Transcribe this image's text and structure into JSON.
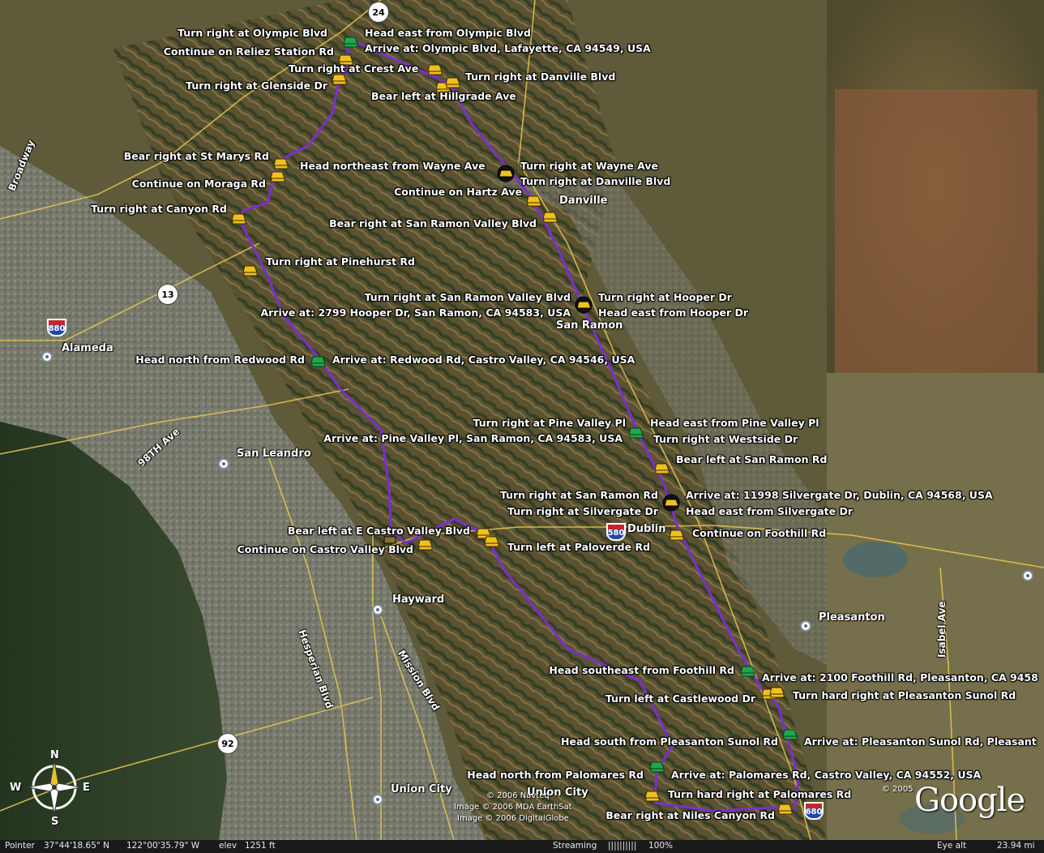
{
  "status_bar": {
    "pointer_label": "Pointer",
    "latitude": "37°44'18.65\" N",
    "longitude": "122°00'35.79\" W",
    "elev_label": "elev",
    "elevation": "1251 ft",
    "streaming_label": "Streaming",
    "streaming_bars": "||||||||||",
    "streaming_percent": "100%",
    "eye_alt_label": "Eye alt",
    "eye_alt": "23.94 mi"
  },
  "attribution": {
    "lines": [
      "© 2006 Navteq",
      "Image © 2006 MDA EarthSat",
      "Image © 2006 DigitalGlobe"
    ],
    "logo_year": "© 2005",
    "logo_text": "Google"
  },
  "compass": {
    "n": "N",
    "s": "S",
    "e": "E",
    "w": "W"
  },
  "shields": [
    {
      "label": "24",
      "kind": "state"
    },
    {
      "label": "13",
      "kind": "state"
    },
    {
      "label": "92",
      "kind": "state"
    },
    {
      "label": "880",
      "kind": "interstate"
    },
    {
      "label": "580",
      "kind": "interstate"
    },
    {
      "label": "680",
      "kind": "interstate"
    }
  ],
  "cities": [
    "Danville",
    "San Ramon",
    "Alameda",
    "San Leandro",
    "Dublin",
    "Hayward",
    "Pleasanton",
    "Union City",
    "Union City"
  ],
  "roads": [
    "Broadway",
    "98TH Ave",
    "Hesperian Blvd",
    "Mission Blvd",
    "Isabel Ave"
  ],
  "directions": [
    "Turn right at Olympic Blvd",
    "Head  east from Olympic Blvd",
    "Continue on Reliez Station Rd",
    "Arrive at: Olympic Blvd, Lafayette, CA 94549, USA",
    "Turn right at Crest Ave",
    "Turn right at Danville Blvd",
    "Turn right at Glenside Dr",
    "Bear left at Hillgrade Ave",
    "Bear right at St Marys Rd",
    "Head  northeast from Wayne Ave",
    "Turn right at Wayne Ave",
    "Continue on Moraga Rd",
    "Turn right at Danville Blvd",
    "Continue on Hartz Ave",
    "Turn right at Canyon Rd",
    "Bear right at San Ramon Valley Blvd",
    "Turn right at Pinehurst Rd",
    "Turn right at San Ramon Valley Blvd",
    "Turn right at Hooper Dr",
    "Arrive at: 2799 Hooper Dr, San Ramon, CA 94583, USA",
    "Head  east from Hooper Dr",
    "Head  north from Redwood Rd",
    "Arrive at: Redwood Rd, Castro Valley, CA 94546, USA",
    "Turn right at Pine Valley Pl",
    "Head  east from Pine Valley Pl",
    "Arrive at: Pine Valley Pl, San Ramon, CA 94583, USA",
    "Turn right at Westside Dr",
    "Bear left at San Ramon Rd",
    "Turn right at San Ramon Rd",
    "Arrive at: 11998 Silvergate Dr, Dublin, CA 94568, USA",
    "Turn right at Silvergate Dr",
    "Head  east from Silvergate Dr",
    "Bear left at E Castro Valley Blvd",
    "Continue on Foothill Rd",
    "Continue on Castro Valley Blvd",
    "Turn left at Paloverde Rd",
    "Head  southeast from Foothill Rd",
    "Arrive at: 2100 Foothill Rd, Pleasanton, CA 9458",
    "Turn left at Castlewood Dr",
    "Turn hard right at Pleasanton Sunol Rd",
    "Head  south from Pleasanton Sunol Rd",
    "Arrive at: Pleasanton Sunol Rd, Pleasant",
    "Head  north from Palomares Rd",
    "Arrive at: Palomares Rd, Castro Valley, CA 94552, USA",
    "Turn hard right at Palomares Rd",
    "Bear right at Niles Canyon Rd"
  ],
  "colors": {
    "route": "#7a2fd0",
    "marker_start": "#1fa84a",
    "marker_step": "#f0c020",
    "label_text": "#ffffff"
  }
}
